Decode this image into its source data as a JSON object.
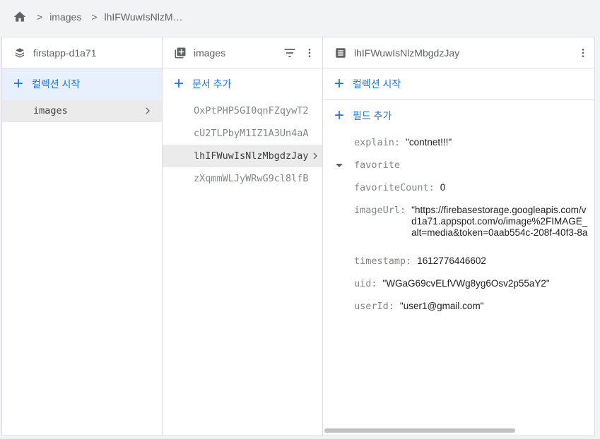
{
  "breadcrumb": {
    "items": [
      "images",
      "lhIFWuwIsNlzM…"
    ],
    "separator": ">"
  },
  "col1": {
    "title": "firstapp-d1a71",
    "start_collection": "컬렉션 시작",
    "items": [
      {
        "label": "images"
      }
    ]
  },
  "col2": {
    "title": "images",
    "add_document": "문서 추가",
    "docs": [
      {
        "id": "OxPtPHP5GI0qnFZqywT2"
      },
      {
        "id": "cU2TLPbyM1IZ1A3Un4aA"
      },
      {
        "id": "lhIFWuwIsNlzMbgdzJay"
      },
      {
        "id": "zXqmmWLJyWRwG9cl8lfB"
      }
    ]
  },
  "col3": {
    "title": "lhIFWuwIsNlzMbgdzJay",
    "start_collection": "컬렉션 시작",
    "add_field": "필드 추가",
    "fields": {
      "explain_key": "explain:",
      "explain_val": "\"contnet!!!\"",
      "favorite_key": "favorite",
      "favoriteCount_key": "favoriteCount:",
      "favoriteCount_val": "0",
      "imageUrl_key": "imageUrl:",
      "imageUrl_line1": "\"https://firebasestorage.googleapis.com/v",
      "imageUrl_line2": "d1a71.appspot.com/o/image%2FIMAGE_",
      "imageUrl_line3": "alt=media&token=0aab554c-208f-40f3-8a",
      "timestamp_key": "timestamp:",
      "timestamp_val": "1612776446602",
      "uid_key": "uid:",
      "uid_val": "\"WGaG69cvELfVWg8yg6Osv2p55aY2\"",
      "userId_key": "userId:",
      "userId_val": "\"user1@gmail.com\""
    }
  },
  "colors": {
    "accent": "#1a73e8",
    "selected_bg": "#e8f0fe",
    "item_selected_bg": "#ebebeb"
  },
  "icons": {
    "home": "home-icon",
    "project": "firestore-icon",
    "collection": "collection-icon",
    "document": "document-icon",
    "filter": "filter-icon",
    "more": "more-vert-icon",
    "chevron": "chevron-right-icon"
  }
}
